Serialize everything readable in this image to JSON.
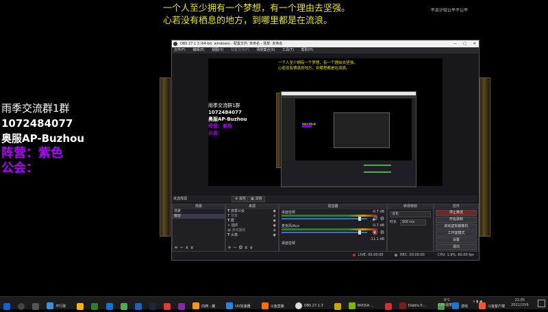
{
  "overlay": {
    "line1": "一个人至少拥有一个梦想，有一个理由去坚强。",
    "line2": "心若没有栖息的地方，到哪里都是在流浪。",
    "corner_text": "不去计较公平不公平",
    "left_text": [
      "雨季交流群1群",
      "1072484077",
      "奥服AP-Buzhou"
    ],
    "left_purple": [
      "阵营：紫色",
      "公会："
    ]
  },
  "obs": {
    "title": "OBS 27.1.3 (64-bit, windows) - 配置文件: 未命名 - 场景: 未命名",
    "menu": [
      "文件(F)",
      "编辑(E)",
      "视图(V)",
      "配置文件(P)",
      "场景集合(S)",
      "工具(T)",
      "帮助(H)"
    ],
    "preview_lines": [
      "一个人至少拥有一个梦想，有一个理由去坚强。",
      "心若没有栖息的地方，到哪里都是在流浪。"
    ],
    "preview_left": [
      "雨季交流群1群",
      "1072484077",
      "奥服AP-Buzhou"
    ],
    "preview_purple": [
      "阵营：紫色",
      "公会："
    ],
    "source_label": "未选择源",
    "props_btn": "属性",
    "filter_btn": "滤镜",
    "panels": {
      "scenes": "场景",
      "sources": "来源",
      "mixer": "混音器",
      "transitions": "转场特效",
      "controls": "控件"
    },
    "scenes": [
      "场景",
      "魔兽"
    ],
    "sources": [
      "雨季公会",
      "背景",
      "群",
      "插件",
      "游戏捕获",
      "头像"
    ],
    "mixer": [
      {
        "name": "桌面音频",
        "db": "-0.7 dB"
      },
      {
        "name": "麦克风/Aux",
        "db": "-0.7 dB"
      },
      {
        "name": "桌面音频",
        "db": "-11.1 dB"
      }
    ],
    "transition_select": "淡化",
    "duration_label": "时长",
    "duration_value": "300 ms",
    "controls": [
      "停止推流",
      "开始录制",
      "启动虚拟摄像机",
      "工作室模式",
      "设置",
      "退出"
    ],
    "status": {
      "live": "LIVE: 00:00:00",
      "rec": "REC: 00:00:00",
      "cpu": "CPU: 1.9%, 60.00 fps"
    }
  },
  "taskbar": {
    "items": [
      "平行账",
      "",
      "",
      "",
      "",
      "",
      "",
      "",
      "",
      "",
      "向西 - 魔",
      "UU加速器",
      "斗鱼直播",
      "OBS 27.1.3",
      "",
      "NVIDIA ...",
      "",
      "Diablo II:...",
      "",
      "游戏",
      "斗鱼客户端"
    ],
    "weather": "9°C",
    "weather_sub": "CPU温度...",
    "time": "22:05",
    "date": "2021/10/6"
  }
}
